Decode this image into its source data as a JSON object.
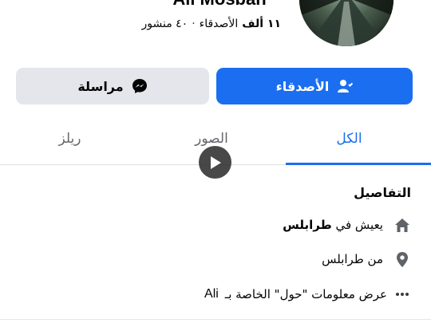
{
  "profile": {
    "name": "Ali Mosbah",
    "friends_count": "١١ ألف",
    "friends_word": "الأصدقاء",
    "separator": "·",
    "posts": "٤٠ منشور"
  },
  "buttons": {
    "friends": {
      "label": "الأصدقاء",
      "icon": "person-check-icon"
    },
    "message": {
      "label": "مراسلة",
      "icon": "messenger-icon"
    }
  },
  "tabs": [
    {
      "label": "الكل",
      "active": true
    },
    {
      "label": "الصور",
      "active": false
    },
    {
      "label": "ريلز",
      "active": false
    }
  ],
  "details": {
    "title": "التفاصيل",
    "lives_prefix": "يعيش في",
    "lives_city": "طرابلس",
    "from": "من طرابلس",
    "about": "عرض معلومات \"حول\" الخاصة بـ",
    "about_name": "Ali"
  },
  "colors": {
    "accent": "#1b6ef0",
    "secondary_button": "#e4e6eb",
    "muted_text": "#65676b"
  }
}
